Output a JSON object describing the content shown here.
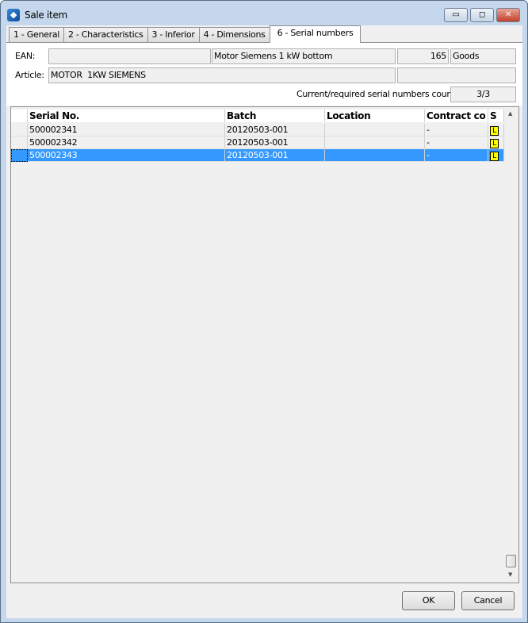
{
  "window": {
    "title": "Sale item",
    "minimize": "▭",
    "maximize": "◻",
    "close": "✕"
  },
  "tabs": [
    {
      "label": "1 - General"
    },
    {
      "label": "2 - Characteristics"
    },
    {
      "label": "3 - Inferior"
    },
    {
      "label": "4 - Dimensions"
    },
    {
      "label": "6 - Serial numbers",
      "active": true
    }
  ],
  "form": {
    "ean_label": "EAN:",
    "ean_value": "",
    "description": "Motor Siemens 1 kW bottom",
    "number": "165",
    "type": "Goods",
    "article_label": "Article:",
    "article_value": "MOTOR  1KW SIEMENS",
    "article_extra": "",
    "count_label": "Current/required serial numbers count:",
    "count_value": "3/3"
  },
  "grid": {
    "columns": [
      "Serial No.",
      "Batch",
      "Location",
      "Contract co",
      "S"
    ],
    "rows": [
      {
        "serial": "500002341",
        "batch": "20120503-001",
        "location": "",
        "contract": "-",
        "s": "L"
      },
      {
        "serial": "500002342",
        "batch": "20120503-001",
        "location": "",
        "contract": "-",
        "s": "L"
      },
      {
        "serial": "500002343",
        "batch": "20120503-001",
        "location": "",
        "contract": "-",
        "s": "L",
        "selected": true
      }
    ]
  },
  "buttons": {
    "ok": "OK",
    "cancel": "Cancel"
  },
  "colors": {
    "selection": "#3399ff",
    "badge": "#ffff00"
  }
}
